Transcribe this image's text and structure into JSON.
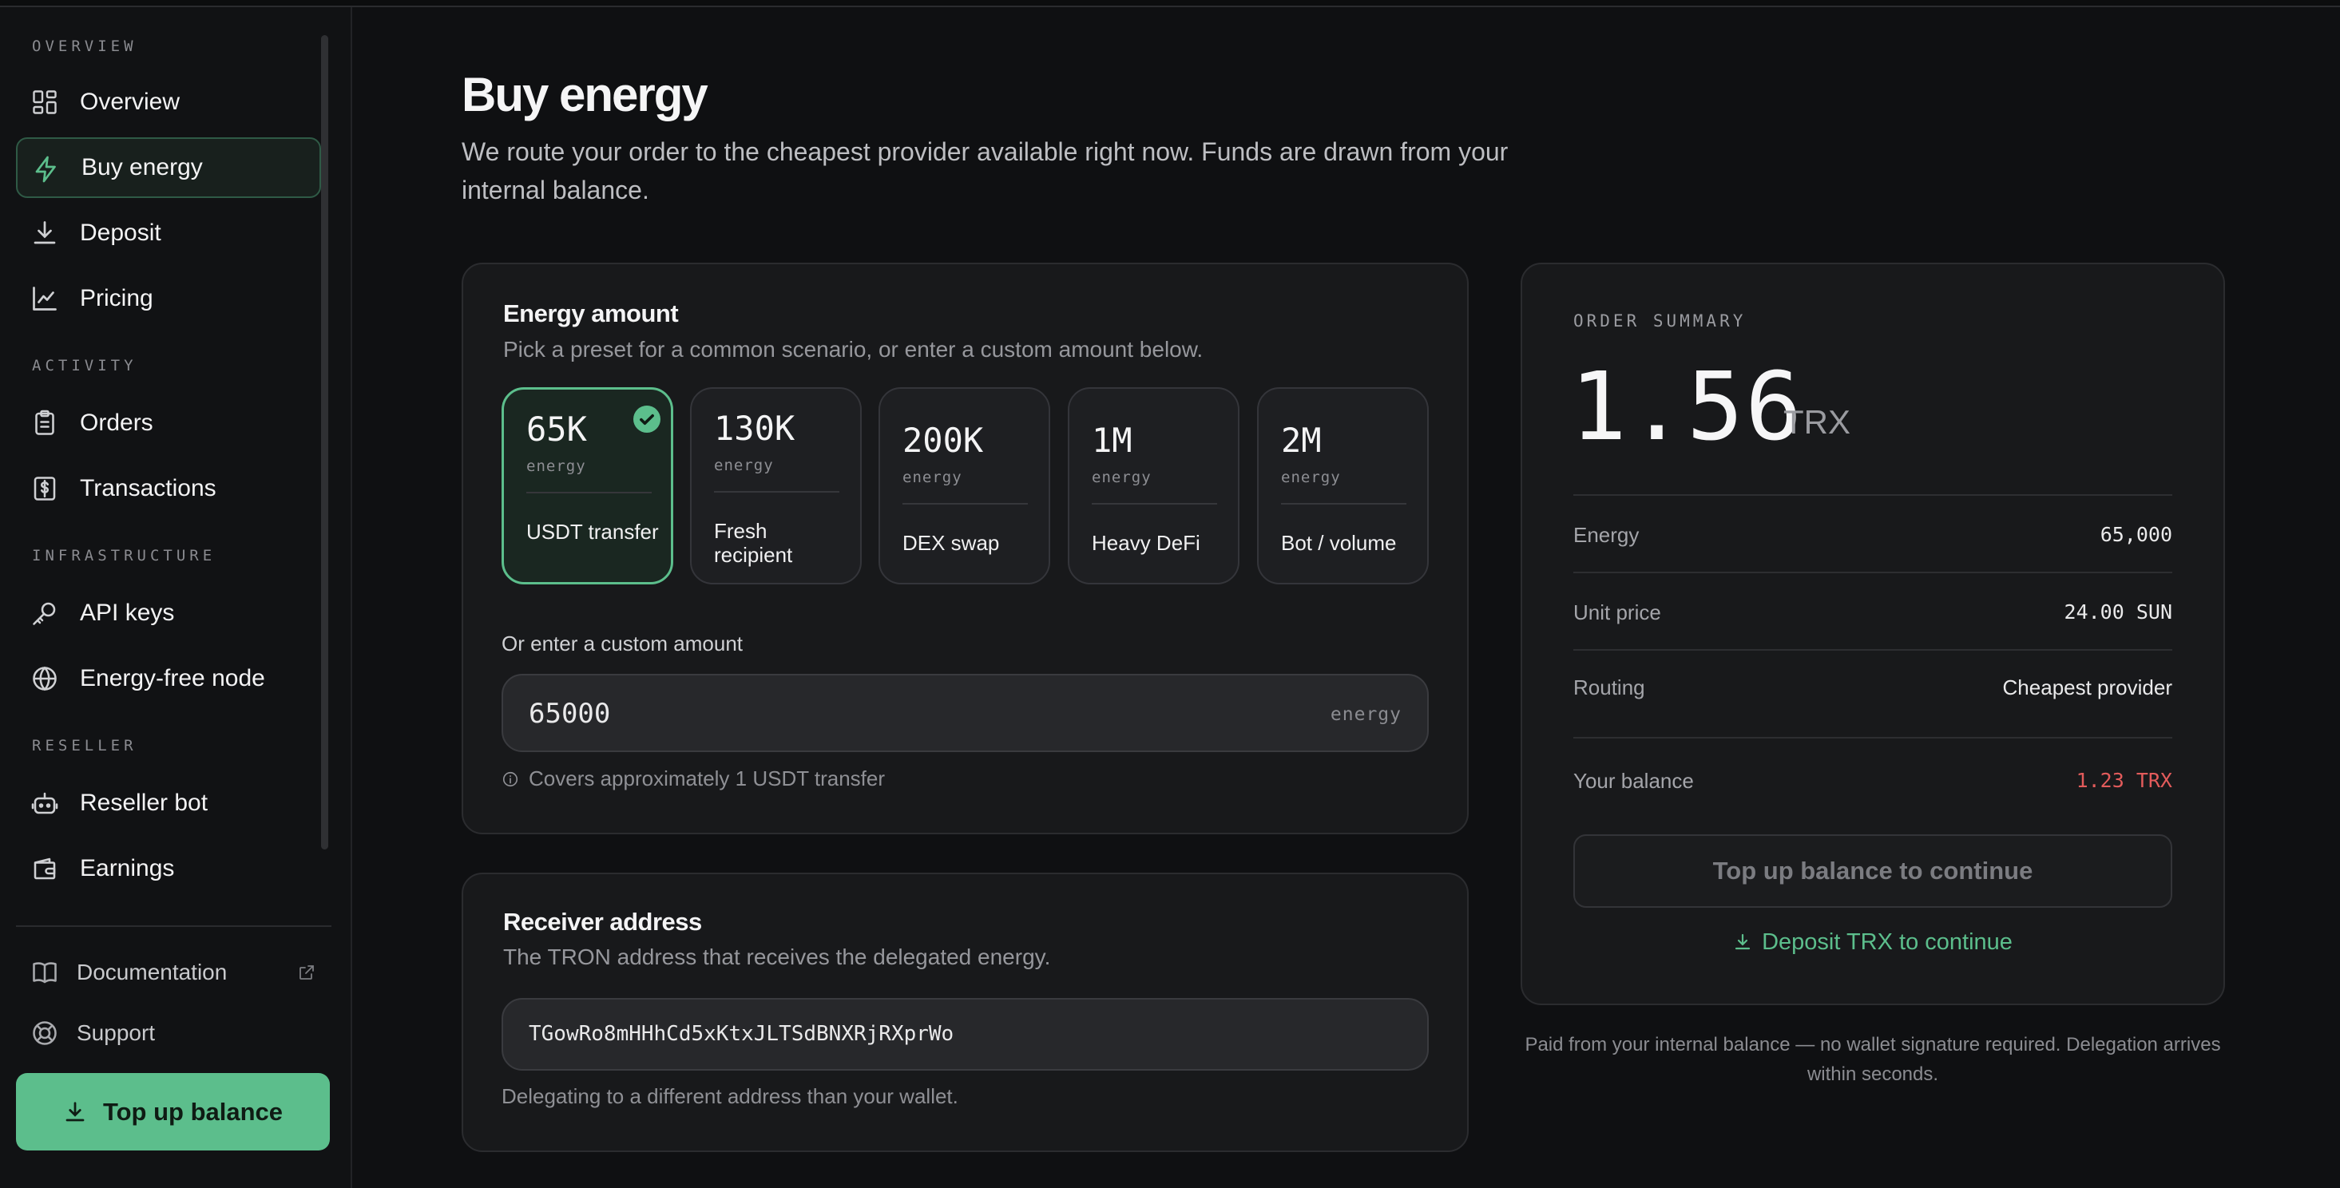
{
  "sidebar": {
    "sections": [
      "OVERVIEW",
      "ACTIVITY",
      "INFRASTRUCTURE",
      "RESELLER"
    ],
    "items": [
      {
        "label": "Overview",
        "icon": "grid-icon"
      },
      {
        "label": "Buy energy",
        "icon": "lightning-icon",
        "active": true
      },
      {
        "label": "Deposit",
        "icon": "download-icon"
      },
      {
        "label": "Pricing",
        "icon": "chart-line-icon"
      },
      {
        "label": "Orders",
        "icon": "clipboard-icon"
      },
      {
        "label": "Transactions",
        "icon": "dollar-receipt-icon"
      },
      {
        "label": "API keys",
        "icon": "key-icon"
      },
      {
        "label": "Energy-free node",
        "icon": "globe-icon"
      },
      {
        "label": "Reseller bot",
        "icon": "bot-icon"
      },
      {
        "label": "Earnings",
        "icon": "wallet-icon"
      }
    ],
    "footer": [
      {
        "label": "Documentation",
        "icon": "book-icon"
      },
      {
        "label": "Support",
        "icon": "lifebuoy-icon"
      }
    ],
    "topup_label": "Top up balance"
  },
  "page": {
    "title": "Buy energy",
    "subtitle": "We route your order to the cheapest provider available right now. Funds are drawn from your internal balance."
  },
  "energy_card": {
    "title": "Energy amount",
    "subtitle": "Pick a preset for a common scenario, or enter a custom amount below.",
    "presets": [
      {
        "value": "65K",
        "unit": "energy",
        "label": "USDT transfer",
        "selected": true
      },
      {
        "value": "130K",
        "unit": "energy",
        "label": "Fresh recipient"
      },
      {
        "value": "200K",
        "unit": "energy",
        "label": "DEX swap"
      },
      {
        "value": "1M",
        "unit": "energy",
        "label": "Heavy DeFi"
      },
      {
        "value": "2M",
        "unit": "energy",
        "label": "Bot / volume"
      }
    ],
    "custom_label": "Or enter a custom amount",
    "custom_value": "65000",
    "custom_suffix": "energy",
    "hint": "Covers approximately 1 USDT transfer"
  },
  "receiver_card": {
    "title": "Receiver address",
    "subtitle": "The TRON address that receives the delegated energy.",
    "address": "TGowRo8mHHhCd5xKtxJLTSdBNXRjRXprWo",
    "note": "Delegating to a different address than your wallet."
  },
  "summary": {
    "label": "ORDER SUMMARY",
    "total": "1.56",
    "unit": "TRX",
    "rows": [
      {
        "label": "Energy",
        "value": "65,000"
      },
      {
        "label": "Unit price",
        "value": "24.00 SUN"
      },
      {
        "label": "Routing",
        "value": "Cheapest provider"
      },
      {
        "label": "Your balance",
        "value": "1.23 TRX"
      }
    ],
    "button_label": "Top up balance to continue",
    "deposit_link": "Deposit TRX to continue",
    "footnote": "Paid from your internal balance — no wallet signature required. Delegation arrives within seconds."
  },
  "colors": {
    "accent": "#5cbe8c",
    "danger": "#e25b5b",
    "background": "#0f1012",
    "card": "#18191b"
  }
}
